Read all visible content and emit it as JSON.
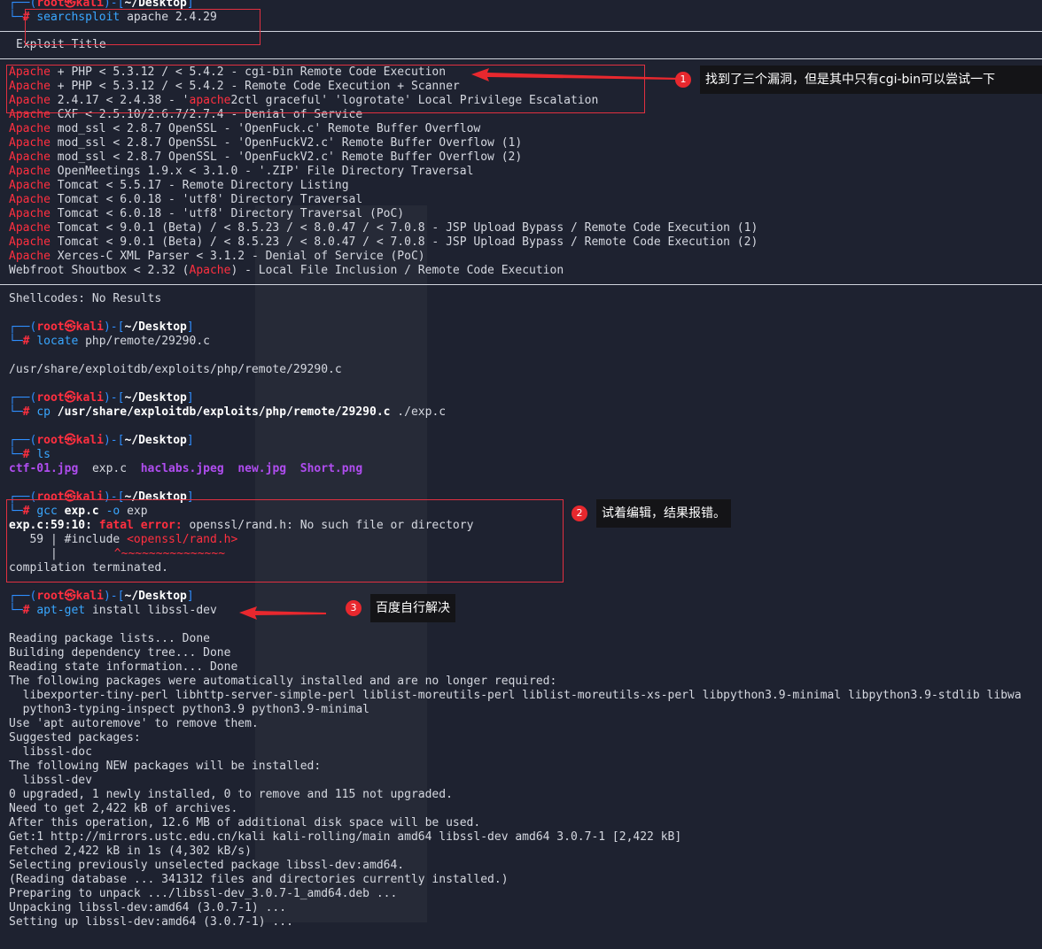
{
  "prompt": {
    "user": "root",
    "at": "㉿",
    "host": "kali",
    "dir": "~/Desktop",
    "hash": "#"
  },
  "cmd1": {
    "name": "searchsploit",
    "args": "apache 2.4.29"
  },
  "exploit_title_header": "Exploit Title",
  "results": [
    {
      "pre": "",
      "hl": "Apache",
      "post": " + PHP < 5.3.12 / < 5.4.2 - cgi-bin Remote Code Execution"
    },
    {
      "pre": "",
      "hl": "Apache",
      "post": " + PHP < 5.3.12 / < 5.4.2 - Remote Code Execution + Scanner"
    },
    {
      "pre": "",
      "hl": "Apache",
      "post": " 2.4.17 < 2.4.38 - '",
      "hl2": "apache",
      "post2": "2ctl graceful' 'logrotate' Local Privilege Escalation"
    },
    {
      "pre": "",
      "hl": "Apache",
      "post": " CXF < 2.5.10/2.6.7/2.7.4 - Denial of Service"
    },
    {
      "pre": "",
      "hl": "Apache",
      "post": " mod_ssl < 2.8.7 OpenSSL - 'OpenFuck.c' Remote Buffer Overflow"
    },
    {
      "pre": "",
      "hl": "Apache",
      "post": " mod_ssl < 2.8.7 OpenSSL - 'OpenFuckV2.c' Remote Buffer Overflow (1)"
    },
    {
      "pre": "",
      "hl": "Apache",
      "post": " mod_ssl < 2.8.7 OpenSSL - 'OpenFuckV2.c' Remote Buffer Overflow (2)"
    },
    {
      "pre": "",
      "hl": "Apache",
      "post": " OpenMeetings 1.9.x < 3.1.0 - '.ZIP' File Directory Traversal"
    },
    {
      "pre": "",
      "hl": "Apache",
      "post": " Tomcat < 5.5.17 - Remote Directory Listing"
    },
    {
      "pre": "",
      "hl": "Apache",
      "post": " Tomcat < 6.0.18 - 'utf8' Directory Traversal"
    },
    {
      "pre": "",
      "hl": "Apache",
      "post": " Tomcat < 6.0.18 - 'utf8' Directory Traversal (PoC)"
    },
    {
      "pre": "",
      "hl": "Apache",
      "post": " Tomcat < 9.0.1 (Beta) / < 8.5.23 / < 8.0.47 / < 7.0.8 - JSP Upload Bypass / Remote Code Execution (1)"
    },
    {
      "pre": "",
      "hl": "Apache",
      "post": " Tomcat < 9.0.1 (Beta) / < 8.5.23 / < 8.0.47 / < 7.0.8 - JSP Upload Bypass / Remote Code Execution (2)"
    },
    {
      "pre": "",
      "hl": "Apache",
      "post": " Xerces-C XML Parser < 3.1.2 - Denial of Service (PoC)"
    },
    {
      "pre": "Webfroot Shoutbox < 2.32 (",
      "hl": "Apache",
      "post": ") - Local File Inclusion / Remote Code Execution"
    }
  ],
  "shellcodes": "Shellcodes: No Results",
  "cmd2": {
    "name": "locate",
    "args": "php/remote/29290.c"
  },
  "locate_out": "/usr/share/exploitdb/exploits/php/remote/29290.c",
  "cmd3": {
    "name": "cp",
    "arg_bold": "/usr/share/exploitdb/exploits/php/remote/29290.c",
    "args": " ./exp.c"
  },
  "cmd4": {
    "name": "ls"
  },
  "ls_out": {
    "f1": "ctf-01.jpg",
    "f2": "exp.c",
    "f3": "haclabs.jpeg",
    "f4": "new.jpg",
    "f5": "Short.png"
  },
  "cmd5": {
    "name": "gcc",
    "arg_bold": "exp.c",
    "opt": "-o",
    "args": "exp"
  },
  "gcc": {
    "loc": "exp.c:59:10:",
    "fatal": "fatal error:",
    "msg": " openssl/rand.h: No such file or directory",
    "line_no": "   59 |",
    "include_pre": " #include ",
    "include_hl": "<openssl/rand.h>",
    "bar": "      |",
    "squiggle": "^~~~~~~~~~~~~~~~",
    "terminated": "compilation terminated."
  },
  "cmd6": {
    "name": "apt-get",
    "args": "install libssl-dev"
  },
  "apt_out": [
    "Reading package lists... Done",
    "Building dependency tree... Done",
    "Reading state information... Done",
    "The following packages were automatically installed and are no longer required:",
    "  libexporter-tiny-perl libhttp-server-simple-perl liblist-moreutils-perl liblist-moreutils-xs-perl libpython3.9-minimal libpython3.9-stdlib libwa",
    "  python3-typing-inspect python3.9 python3.9-minimal",
    "Use 'apt autoremove' to remove them.",
    "Suggested packages:",
    "  libssl-doc",
    "The following NEW packages will be installed:",
    "  libssl-dev",
    "0 upgraded, 1 newly installed, 0 to remove and 115 not upgraded.",
    "Need to get 2,422 kB of archives.",
    "After this operation, 12.6 MB of additional disk space will be used.",
    "Get:1 http://mirrors.ustc.edu.cn/kali kali-rolling/main amd64 libssl-dev amd64 3.0.7-1 [2,422 kB]",
    "Fetched 2,422 kB in 1s (4,302 kB/s)",
    "Selecting previously unselected package libssl-dev:amd64.",
    "(Reading database ... 341312 files and directories currently installed.)",
    "Preparing to unpack .../libssl-dev_3.0.7-1_amd64.deb ...",
    "Unpacking libssl-dev:amd64 (3.0.7-1) ...",
    "Setting up libssl-dev:amd64 (3.0.7-1) ..."
  ],
  "annotations": {
    "n1": "1",
    "note1": "找到了三个漏洞，但是其中只有cgi-bin可以尝试一下",
    "n2": "2",
    "note2": "试着编辑，结果报错。",
    "n3": "3",
    "note3": "百度自行解决"
  },
  "colors": {
    "background": "#1e2230",
    "prompt_blue": "#2f8fff",
    "prompt_red": "#ff2f3f",
    "highlight_red": "#ff2f3f",
    "ls_purple": "#b04df0",
    "annotation_red": "#e03040"
  }
}
